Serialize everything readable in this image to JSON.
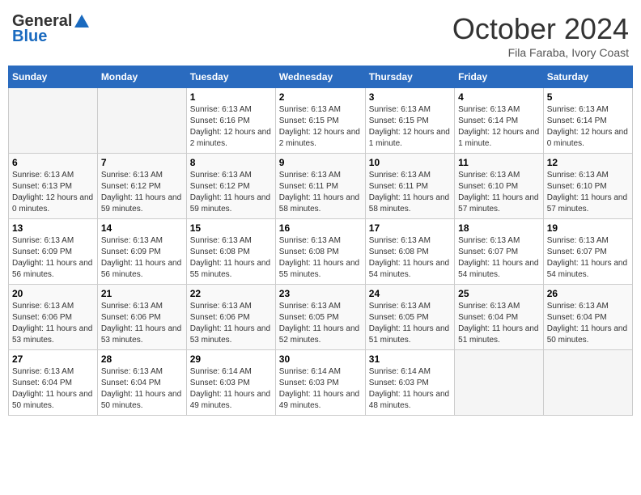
{
  "header": {
    "logo_general": "General",
    "logo_blue": "Blue",
    "month": "October 2024",
    "location": "Fila Faraba, Ivory Coast"
  },
  "weekdays": [
    "Sunday",
    "Monday",
    "Tuesday",
    "Wednesday",
    "Thursday",
    "Friday",
    "Saturday"
  ],
  "weeks": [
    [
      {
        "day": "",
        "info": ""
      },
      {
        "day": "",
        "info": ""
      },
      {
        "day": "1",
        "info": "Sunrise: 6:13 AM\nSunset: 6:16 PM\nDaylight: 12 hours and 2 minutes."
      },
      {
        "day": "2",
        "info": "Sunrise: 6:13 AM\nSunset: 6:15 PM\nDaylight: 12 hours and 2 minutes."
      },
      {
        "day": "3",
        "info": "Sunrise: 6:13 AM\nSunset: 6:15 PM\nDaylight: 12 hours and 1 minute."
      },
      {
        "day": "4",
        "info": "Sunrise: 6:13 AM\nSunset: 6:14 PM\nDaylight: 12 hours and 1 minute."
      },
      {
        "day": "5",
        "info": "Sunrise: 6:13 AM\nSunset: 6:14 PM\nDaylight: 12 hours and 0 minutes."
      }
    ],
    [
      {
        "day": "6",
        "info": "Sunrise: 6:13 AM\nSunset: 6:13 PM\nDaylight: 12 hours and 0 minutes."
      },
      {
        "day": "7",
        "info": "Sunrise: 6:13 AM\nSunset: 6:12 PM\nDaylight: 11 hours and 59 minutes."
      },
      {
        "day": "8",
        "info": "Sunrise: 6:13 AM\nSunset: 6:12 PM\nDaylight: 11 hours and 59 minutes."
      },
      {
        "day": "9",
        "info": "Sunrise: 6:13 AM\nSunset: 6:11 PM\nDaylight: 11 hours and 58 minutes."
      },
      {
        "day": "10",
        "info": "Sunrise: 6:13 AM\nSunset: 6:11 PM\nDaylight: 11 hours and 58 minutes."
      },
      {
        "day": "11",
        "info": "Sunrise: 6:13 AM\nSunset: 6:10 PM\nDaylight: 11 hours and 57 minutes."
      },
      {
        "day": "12",
        "info": "Sunrise: 6:13 AM\nSunset: 6:10 PM\nDaylight: 11 hours and 57 minutes."
      }
    ],
    [
      {
        "day": "13",
        "info": "Sunrise: 6:13 AM\nSunset: 6:09 PM\nDaylight: 11 hours and 56 minutes."
      },
      {
        "day": "14",
        "info": "Sunrise: 6:13 AM\nSunset: 6:09 PM\nDaylight: 11 hours and 56 minutes."
      },
      {
        "day": "15",
        "info": "Sunrise: 6:13 AM\nSunset: 6:08 PM\nDaylight: 11 hours and 55 minutes."
      },
      {
        "day": "16",
        "info": "Sunrise: 6:13 AM\nSunset: 6:08 PM\nDaylight: 11 hours and 55 minutes."
      },
      {
        "day": "17",
        "info": "Sunrise: 6:13 AM\nSunset: 6:08 PM\nDaylight: 11 hours and 54 minutes."
      },
      {
        "day": "18",
        "info": "Sunrise: 6:13 AM\nSunset: 6:07 PM\nDaylight: 11 hours and 54 minutes."
      },
      {
        "day": "19",
        "info": "Sunrise: 6:13 AM\nSunset: 6:07 PM\nDaylight: 11 hours and 54 minutes."
      }
    ],
    [
      {
        "day": "20",
        "info": "Sunrise: 6:13 AM\nSunset: 6:06 PM\nDaylight: 11 hours and 53 minutes."
      },
      {
        "day": "21",
        "info": "Sunrise: 6:13 AM\nSunset: 6:06 PM\nDaylight: 11 hours and 53 minutes."
      },
      {
        "day": "22",
        "info": "Sunrise: 6:13 AM\nSunset: 6:06 PM\nDaylight: 11 hours and 53 minutes."
      },
      {
        "day": "23",
        "info": "Sunrise: 6:13 AM\nSunset: 6:05 PM\nDaylight: 11 hours and 52 minutes."
      },
      {
        "day": "24",
        "info": "Sunrise: 6:13 AM\nSunset: 6:05 PM\nDaylight: 11 hours and 51 minutes."
      },
      {
        "day": "25",
        "info": "Sunrise: 6:13 AM\nSunset: 6:04 PM\nDaylight: 11 hours and 51 minutes."
      },
      {
        "day": "26",
        "info": "Sunrise: 6:13 AM\nSunset: 6:04 PM\nDaylight: 11 hours and 50 minutes."
      }
    ],
    [
      {
        "day": "27",
        "info": "Sunrise: 6:13 AM\nSunset: 6:04 PM\nDaylight: 11 hours and 50 minutes."
      },
      {
        "day": "28",
        "info": "Sunrise: 6:13 AM\nSunset: 6:04 PM\nDaylight: 11 hours and 50 minutes."
      },
      {
        "day": "29",
        "info": "Sunrise: 6:14 AM\nSunset: 6:03 PM\nDaylight: 11 hours and 49 minutes."
      },
      {
        "day": "30",
        "info": "Sunrise: 6:14 AM\nSunset: 6:03 PM\nDaylight: 11 hours and 49 minutes."
      },
      {
        "day": "31",
        "info": "Sunrise: 6:14 AM\nSunset: 6:03 PM\nDaylight: 11 hours and 48 minutes."
      },
      {
        "day": "",
        "info": ""
      },
      {
        "day": "",
        "info": ""
      }
    ]
  ]
}
